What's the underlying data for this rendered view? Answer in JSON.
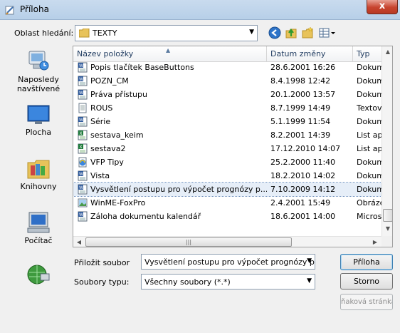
{
  "window": {
    "title": "Příloha",
    "close_label": "x"
  },
  "lookin": {
    "label": "Oblast hledání:",
    "value": "TEXTY"
  },
  "places": [
    {
      "label": "Naposledy navštívené",
      "icon": "recent-places-icon"
    },
    {
      "label": "Plocha",
      "icon": "desktop-icon"
    },
    {
      "label": "Knihovny",
      "icon": "libraries-icon"
    },
    {
      "label": "Počítač",
      "icon": "computer-icon"
    },
    {
      "label": "",
      "icon": "network-icon"
    }
  ],
  "columns": {
    "name": "Název položky",
    "date": "Datum změny",
    "type": "Typ"
  },
  "files": [
    {
      "name": "Popis tlačítek BaseButtons",
      "date": "28.6.2001 16:26",
      "type": "Dokum",
      "icon": "word-document-icon"
    },
    {
      "name": "POZN_CM",
      "date": "8.4.1998 12:42",
      "type": "Dokum",
      "icon": "word-document-icon"
    },
    {
      "name": "Práva přístupu",
      "date": "20.1.2000 13:57",
      "type": "Dokum",
      "icon": "word-document-icon"
    },
    {
      "name": "ROUS",
      "date": "8.7.1999 14:49",
      "type": "Textov",
      "icon": "text-file-icon"
    },
    {
      "name": "Série",
      "date": "5.1.1999 11:54",
      "type": "Dokum",
      "icon": "word-document-icon"
    },
    {
      "name": "sestava_keim",
      "date": "8.2.2001 14:39",
      "type": "List ap",
      "icon": "excel-sheet-icon"
    },
    {
      "name": "sestava2",
      "date": "17.12.2010 14:07",
      "type": "List ap",
      "icon": "excel-sheet-icon"
    },
    {
      "name": "VFP Tipy",
      "date": "25.2.2000 11:40",
      "type": "Dokum",
      "icon": "html-document-icon"
    },
    {
      "name": "Vista",
      "date": "18.2.2010 14:02",
      "type": "Dokum",
      "icon": "word-document-icon"
    },
    {
      "name": "Vysvětlení postupu pro výpočet prognózy p...",
      "date": "7.10.2009 14:12",
      "type": "Dokum",
      "icon": "word-document-icon"
    },
    {
      "name": "WinME-FoxPro",
      "date": "2.4.2001 15:49",
      "type": "Obráze",
      "icon": "image-file-icon"
    },
    {
      "name": "Záloha dokumentu kalendář",
      "date": "18.6.2001 14:00",
      "type": "Micros",
      "icon": "word-document-icon"
    }
  ],
  "selected_index": 9,
  "form": {
    "file_label": "Přiložit soubor",
    "file_value": "Vysvětlení postupu pro výpočet prognózy potře",
    "type_label": "Soubory typu:",
    "type_value": "Všechny soubory (*.*)"
  },
  "buttons": {
    "ok": "Příloha",
    "cancel": "Storno",
    "web": "ňaková stránka"
  },
  "colors": {
    "selection": "#e6eef8",
    "close": "#c7432e",
    "word": "#2b579a",
    "excel": "#1d7a3a"
  }
}
